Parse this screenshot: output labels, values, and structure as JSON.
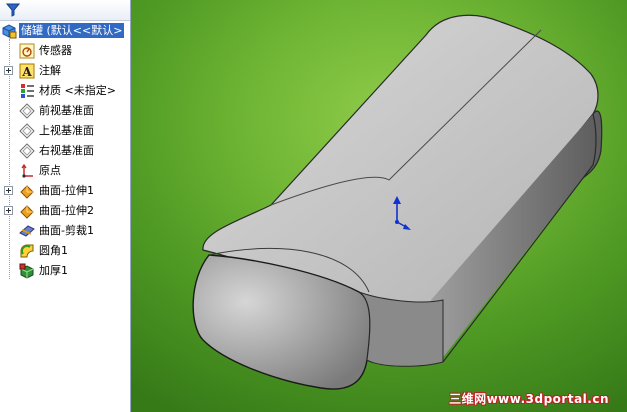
{
  "feature_tree": {
    "root": {
      "label": "储罐 (默认<<默认>",
      "icon": "part-icon"
    },
    "items": [
      {
        "label": "传感器",
        "icon": "sensor-icon",
        "expandable": false
      },
      {
        "label": "注解",
        "icon": "annotation-icon",
        "expandable": true
      },
      {
        "label": "材质 <未指定>",
        "icon": "material-icon",
        "expandable": false
      },
      {
        "label": "前视基准面",
        "icon": "plane-icon",
        "expandable": false
      },
      {
        "label": "上视基准面",
        "icon": "plane-icon",
        "expandable": false
      },
      {
        "label": "右视基准面",
        "icon": "plane-icon",
        "expandable": false
      },
      {
        "label": "原点",
        "icon": "origin-icon",
        "expandable": false
      },
      {
        "label": "曲面-拉伸1",
        "icon": "surface-extrude-icon",
        "expandable": true
      },
      {
        "label": "曲面-拉伸2",
        "icon": "surface-extrude-icon",
        "expandable": true
      },
      {
        "label": "曲面-剪裁1",
        "icon": "surface-trim-icon",
        "expandable": false
      },
      {
        "label": "圆角1",
        "icon": "fillet-icon",
        "expandable": false
      },
      {
        "label": "加厚1",
        "icon": "thicken-icon",
        "expandable": false
      }
    ]
  },
  "filter": {
    "icon": "filter-icon"
  },
  "viewport": {
    "background_color": "#5fa82a"
  },
  "watermark": "三维网www.3dportal.cn"
}
